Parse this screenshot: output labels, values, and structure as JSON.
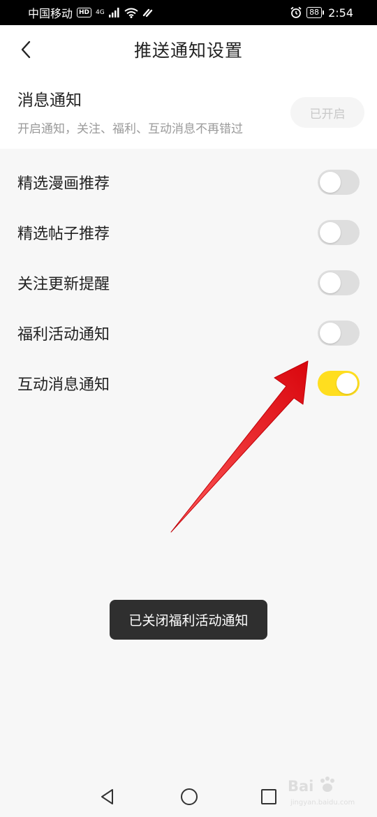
{
  "status_bar": {
    "carrier": "中国移动",
    "hd": "HD",
    "network": "4G",
    "battery": "88",
    "time": "2:54",
    "icons": [
      "signal-icon",
      "wifi-icon",
      "alarm-icon",
      "battery-icon"
    ]
  },
  "header": {
    "title": "推送通知设置",
    "back_icon": "chevron-left-icon"
  },
  "master": {
    "title": "消息通知",
    "description": "开启通知，关注、福利、互动消息不再错过",
    "status_label": "已开启"
  },
  "settings": {
    "items": [
      {
        "label": "精选漫画推荐",
        "enabled": false
      },
      {
        "label": "精选帖子推荐",
        "enabled": false
      },
      {
        "label": "关注更新提醒",
        "enabled": false
      },
      {
        "label": "福利活动通知",
        "enabled": false
      },
      {
        "label": "互动消息通知",
        "enabled": true
      }
    ]
  },
  "toast": {
    "message": "已关闭福利活动通知"
  },
  "nav_bar": {
    "icons": [
      "back-triangle-icon",
      "home-circle-icon",
      "recent-square-icon"
    ]
  },
  "watermark": {
    "brand": "Bai",
    "sub": "jingyan.baidu.com"
  },
  "colors": {
    "toggle_on": "#ffde1f",
    "toggle_off": "#dedede",
    "toast_bg": "#2f2f2f",
    "annotation_arrow": "#e8141b"
  }
}
